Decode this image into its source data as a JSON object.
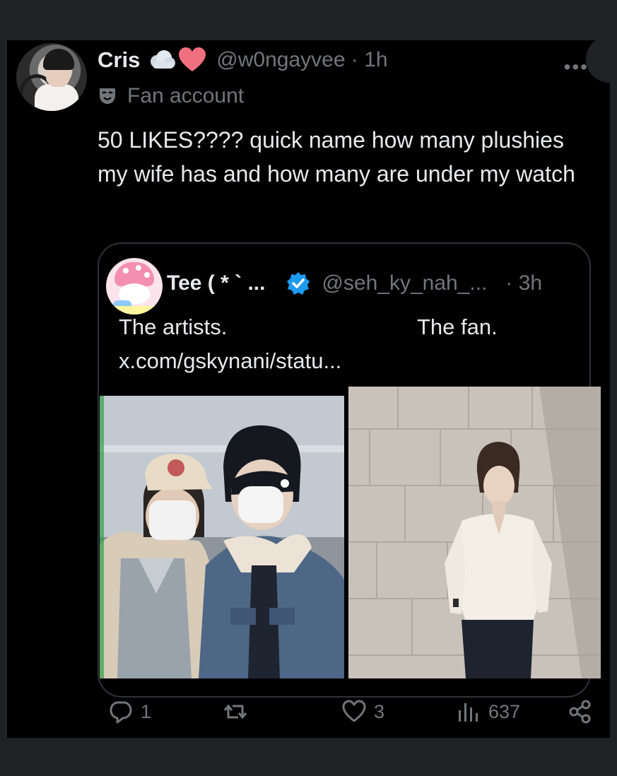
{
  "post": {
    "author_name": "Cris",
    "author_emoji": "cloud-heart",
    "handle": "@w0ngayvee",
    "separator": "·",
    "time": "1h",
    "label": "Fan account",
    "text": "50 LIKES???? quick name how many plushies my wife has and how many are under my watch",
    "more": "•••"
  },
  "quote": {
    "author_name": "Tee ( * ` ...",
    "verified": true,
    "handle": "@seh_ky_nah_...",
    "time": "· 3h",
    "text_left": "The artists.",
    "text_right": "The fan.",
    "link": "x.com/gskynani/statu..."
  },
  "actions": {
    "replies": "1",
    "reposts": "",
    "likes": "3",
    "views": "637"
  },
  "colors": {
    "background": "#000000",
    "outer": "#202124",
    "text": "#e7e9ea",
    "muted": "#71767b",
    "verified": "#1d9bf0",
    "heart": "#f1707f"
  }
}
